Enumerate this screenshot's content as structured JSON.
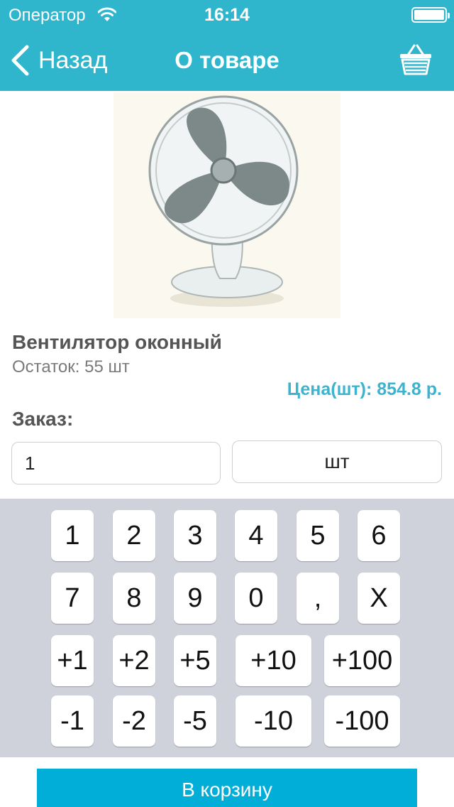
{
  "status_bar": {
    "carrier": "Оператор",
    "time": "16:14"
  },
  "nav": {
    "back_label": "Назад",
    "title": "О товаре"
  },
  "product": {
    "name": "Вентилятор оконный",
    "stock": "Остаток: 55 шт",
    "price": "Цена(шт): 854.8 р."
  },
  "order": {
    "label": "Заказ:",
    "quantity": "1",
    "unit": "шт"
  },
  "keypad": {
    "rows": [
      [
        "1",
        "2",
        "3",
        "4",
        "5",
        "6"
      ],
      [
        "7",
        "8",
        "9",
        "0",
        ",",
        "X"
      ],
      [
        "+1",
        "+2",
        "+5",
        "+10",
        "+100"
      ],
      [
        "-1",
        "-2",
        "-5",
        "-10",
        "-100"
      ]
    ]
  },
  "cart_button": "В корзину",
  "colors": {
    "accent": "#2fb6cc",
    "price": "#3ab4d0",
    "cart": "#00aed8",
    "keypad_bg": "#cfd2db"
  },
  "icons": [
    "wifi-icon",
    "battery-icon",
    "back-chevron-icon",
    "basket-icon"
  ]
}
